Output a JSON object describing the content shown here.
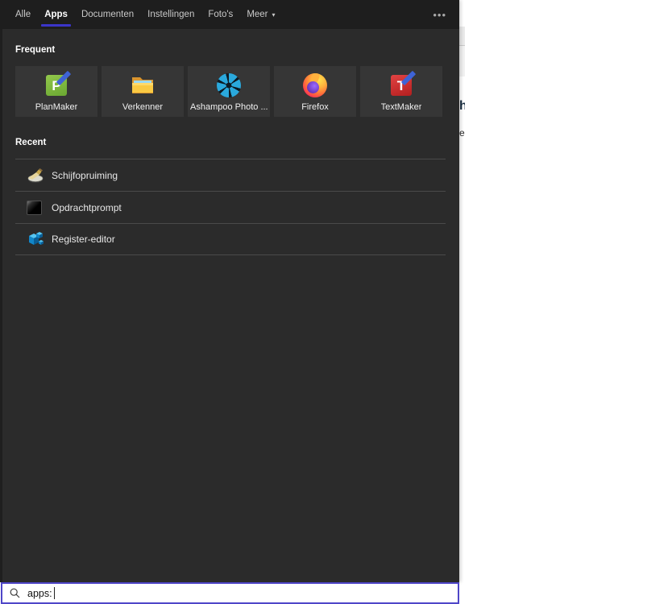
{
  "tabs": {
    "items": [
      {
        "label": "Alle",
        "active": false
      },
      {
        "label": "Apps",
        "active": true
      },
      {
        "label": "Documenten",
        "active": false
      },
      {
        "label": "Instellingen",
        "active": false
      },
      {
        "label": "Foto's",
        "active": false
      },
      {
        "label": "Meer",
        "active": false,
        "has_dropdown": true
      }
    ],
    "dropdown_arrow": "▾",
    "overflow_menu": "•••"
  },
  "frequent": {
    "title": "Frequent",
    "tiles": [
      {
        "label": "PlanMaker",
        "icon": "planmaker-icon",
        "letter": "P"
      },
      {
        "label": "Verkenner",
        "icon": "file-explorer-icon"
      },
      {
        "label": "Ashampoo Photo ...",
        "icon": "aperture-icon"
      },
      {
        "label": "Firefox",
        "icon": "firefox-icon"
      },
      {
        "label": "TextMaker",
        "icon": "textmaker-icon",
        "letter": "T"
      }
    ]
  },
  "recent": {
    "title": "Recent",
    "items": [
      {
        "label": "Schijfopruiming",
        "icon": "disk-cleanup-icon"
      },
      {
        "label": "Opdrachtprompt",
        "icon": "command-prompt-icon"
      },
      {
        "label": "Register-editor",
        "icon": "registry-editor-icon"
      }
    ]
  },
  "search": {
    "value": "apps:"
  },
  "background_window": {
    "fragments": {
      "a": "h",
      "b": "e"
    }
  },
  "colors": {
    "accent": "#3b35c9",
    "search_border": "#4f46c8",
    "topbar": "#1e1e1e",
    "panel": "#2b2b2b",
    "tile": "#363636"
  }
}
